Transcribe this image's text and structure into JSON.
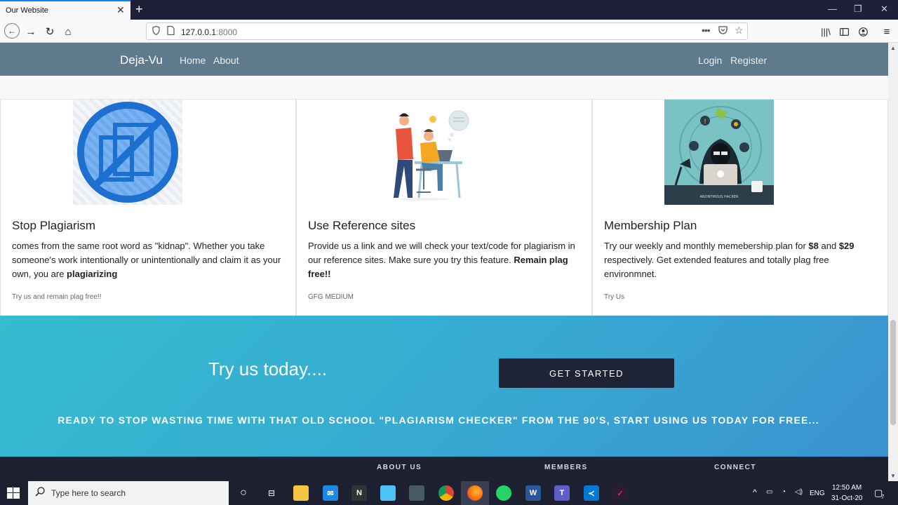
{
  "browser": {
    "tab_title": "Our Website",
    "url_host": "127.0.0.1",
    "url_port": ":8000"
  },
  "site": {
    "brand": "Deja-Vu",
    "nav_left": [
      "Home",
      "About"
    ],
    "nav_right": [
      "Login",
      "Register"
    ]
  },
  "cards": [
    {
      "title": "Stop Plagiarism",
      "text_plain": "comes from the same root word as \"kidnap\". Whether you take someone's work intentionally or unintentionally and claim it as your own, you are ",
      "text_bold": "plagiarizing",
      "footer": "Try us and remain plag free!!"
    },
    {
      "title": "Use Reference sites",
      "text_plain": "Provide us a link and we will check your text/code for plagiarism in our reference sites. Make sure you try this feature. ",
      "text_bold": "Remain plag free!!",
      "footer": "GFG MEDIUM"
    },
    {
      "title": "Membership Plan",
      "text_a": "Try our weekly and monthly memebership plan for ",
      "price_1": "$8",
      "text_b": " and ",
      "price_2": "$29",
      "text_c": " respectively. Get extended features and totally plag free environmnet.",
      "footer": "Try Us",
      "image_caption": "ANONYMOUS HACKER"
    }
  ],
  "cta": {
    "title": "Try us today....",
    "button": "GET STARTED",
    "subtitle": "READY TO STOP WASTING TIME WITH THAT OLD SCHOOL \"PLAGIARISM CHECKER\" FROM THE 90'S, START USING US TODAY FOR FREE..."
  },
  "footer": {
    "headings": [
      "ABOUT US",
      "MEMBERS",
      "CONNECT"
    ]
  },
  "taskbar": {
    "search_placeholder": "Type here to search",
    "lang": "ENG",
    "time": "12:50 AM",
    "date": "31-Oct-20",
    "notification_count": "7"
  },
  "colors": {
    "nav_bg": "#5f7a8c",
    "cta_gradient_start": "#35bccf",
    "cta_gradient_end": "#3a92cf",
    "button_bg": "#1e2336",
    "footer_bg": "#1e2132"
  }
}
